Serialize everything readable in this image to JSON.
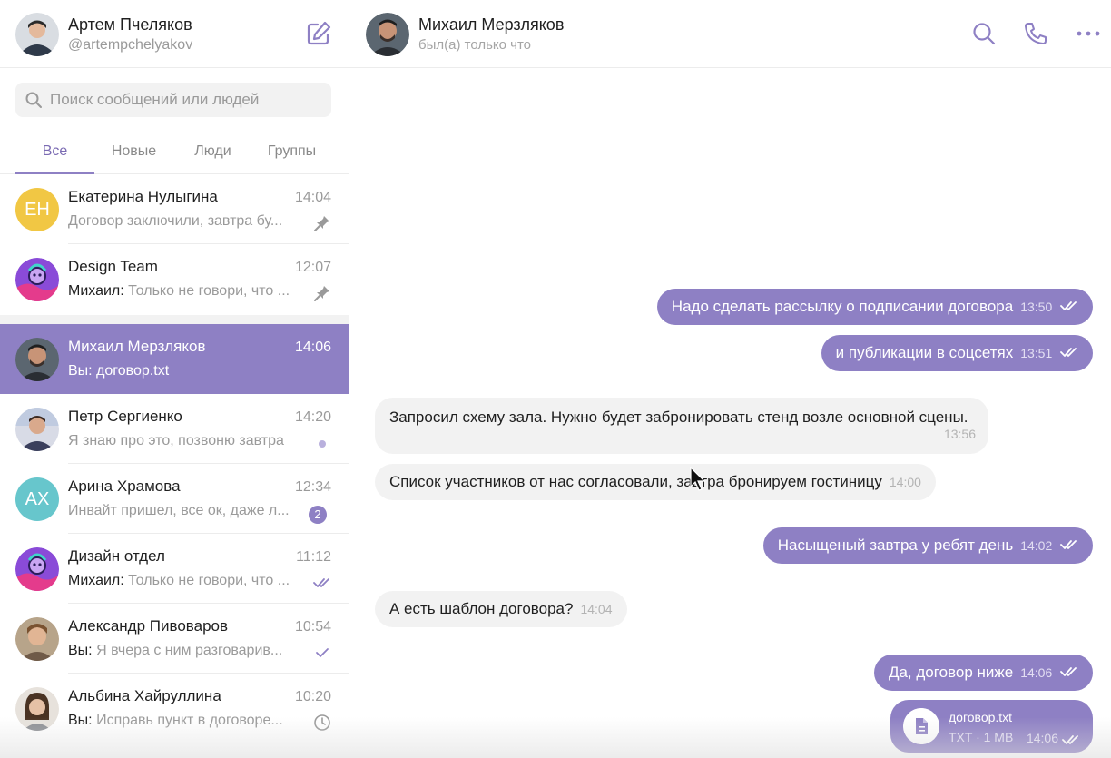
{
  "profile": {
    "name": "Артем Пчеляков",
    "handle": "@artempchelyakov"
  },
  "search": {
    "placeholder": "Поиск сообщений или людей"
  },
  "tabs": [
    {
      "label": "Все",
      "active": true
    },
    {
      "label": "Новые"
    },
    {
      "label": "Люди"
    },
    {
      "label": "Группы"
    }
  ],
  "chats": [
    {
      "title": "Екатерина Нулыгина",
      "initials": "ЕН",
      "avatar_color": "#f1c744",
      "time": "14:04",
      "who": "",
      "preview": "Договор заключили, завтра бу...",
      "status": "pinned"
    },
    {
      "title": "Design Team",
      "time": "12:07",
      "who": "Михаил:",
      "preview": "Только не говори, что ...",
      "status": "pinned"
    },
    {
      "title": "Михаил Мерзляков",
      "time": "14:06",
      "who": "",
      "preview": "Вы: договор.txt",
      "status": "none"
    },
    {
      "title": "Петр Сергиенко",
      "time": "14:20",
      "who": "",
      "preview": "Я знаю про это, позвоню завтра",
      "status": "unread-dot"
    },
    {
      "title": "Арина Храмова",
      "initials": "АХ",
      "avatar_color": "#67c6cc",
      "time": "12:34",
      "who": "",
      "preview": "Инвайт пришел, все ок, даже л...",
      "status": "badge",
      "badge": "2"
    },
    {
      "title": "Дизайн отдел",
      "time": "11:12",
      "who": "Михаил:",
      "preview": "Только не говори, что ...",
      "status": "read"
    },
    {
      "title": "Александр Пивоваров",
      "time": "10:54",
      "who": "Вы:",
      "preview": "Я вчера с ним разговарив...",
      "status": "sent"
    },
    {
      "title": "Альбина Хайруллина",
      "time": "10:20",
      "who": "Вы:",
      "preview": "Исправь пункт в договоре...",
      "status": "pending"
    }
  ],
  "chat_header": {
    "name": "Михаил Мерзляков",
    "status": "был(а) только что"
  },
  "messages": [
    {
      "dir": "out",
      "text": "Надо сделать рассылку о подписании договора",
      "time": "13:50"
    },
    {
      "dir": "out",
      "text": "и публикации в соцсетях",
      "time": "13:51"
    },
    {
      "dir": "in",
      "text": "Запросил схему зала. Нужно будет забронировать стенд возле основной сцены.",
      "time": "13:56"
    },
    {
      "dir": "in",
      "text": "Список участников от нас согласовали, завтра бронируем гостиницу",
      "time": "14:00"
    },
    {
      "dir": "out",
      "text": "Насыщеный завтра у ребят день",
      "time": "14:02"
    },
    {
      "dir": "in",
      "text": "А есть шаблон договора?",
      "time": "14:04"
    },
    {
      "dir": "out",
      "text": "Да, договор ниже",
      "time": "14:06"
    }
  ],
  "file_message": {
    "name": "договор.txt",
    "meta": "TXT · 1 MB",
    "time": "14:06"
  },
  "colors": {
    "accent": "#8e80c4",
    "incoming_bubble": "#f2f2f2",
    "selected_tab": "#7b6bb3"
  }
}
